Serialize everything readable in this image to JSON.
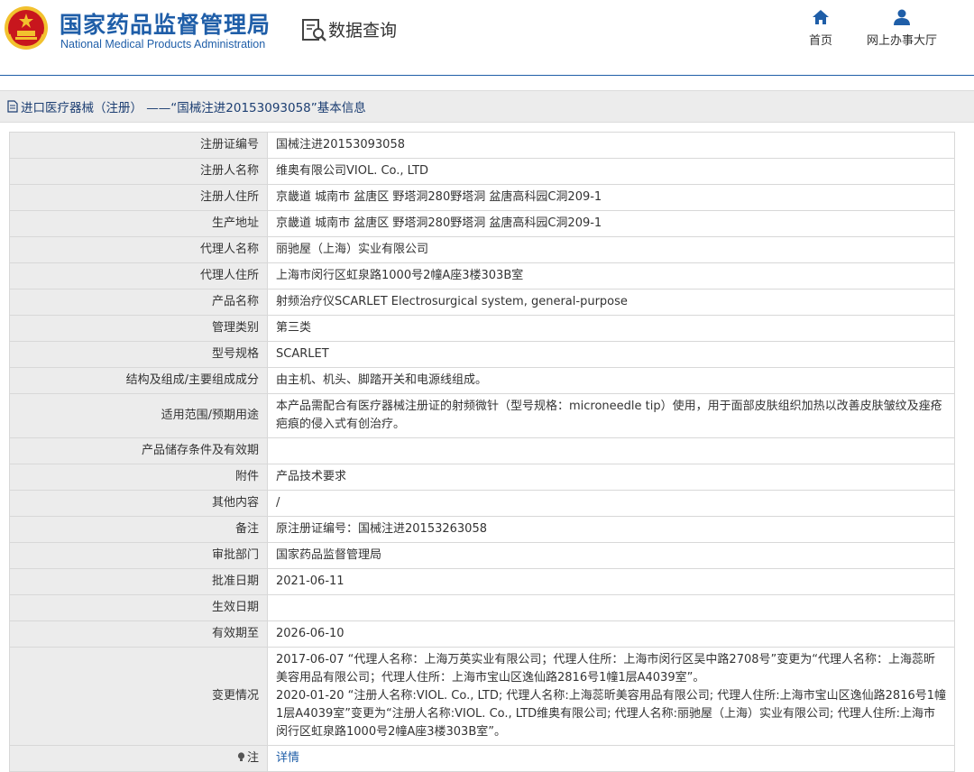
{
  "header": {
    "org_name_cn": "国家药品监督管理局",
    "org_name_en": "National Medical Products Administration",
    "section_title": "数据查询",
    "nav": [
      {
        "label": "首页",
        "icon": "home-icon"
      },
      {
        "label": "网上办事大厅",
        "icon": "user-icon"
      }
    ]
  },
  "page": {
    "title": "进口医疗器械（注册） ——“国械注进20153093058”基本信息"
  },
  "colors": {
    "brand_blue": "#1f5ea8",
    "title_text": "#1c3e72",
    "label_bg": "#ececec",
    "border": "#d8d8d8",
    "link": "#1f5ea8",
    "emblem_red": "#c8161d",
    "emblem_gold": "#f2c12e"
  },
  "record": {
    "rows": [
      {
        "label": "注册证编号",
        "value": "国械注进20153093058"
      },
      {
        "label": "注册人名称",
        "value": "维奥有限公司VIOL. Co., LTD"
      },
      {
        "label": "注册人住所",
        "value": "京畿道 城南市 盆唐区 野塔洞280野塔洞 盆唐高科园C洞209-1"
      },
      {
        "label": "生产地址",
        "value": "京畿道 城南市 盆唐区 野塔洞280野塔洞 盆唐高科园C洞209-1"
      },
      {
        "label": "代理人名称",
        "value": "丽驰屋（上海）实业有限公司"
      },
      {
        "label": "代理人住所",
        "value": "上海市闵行区虹泉路1000号2幢A座3楼303B室"
      },
      {
        "label": "产品名称",
        "value": "射频治疗仪SCARLET Electrosurgical system, general-purpose"
      },
      {
        "label": "管理类别",
        "value": "第三类"
      },
      {
        "label": "型号规格",
        "value": "SCARLET"
      },
      {
        "label": "结构及组成/主要组成成分",
        "value": "由主机、机头、脚踏开关和电源线组成。"
      },
      {
        "label": "适用范围/预期用途",
        "value": "本产品需配合有医疗器械注册证的射频微针（型号规格：microneedle tip）使用，用于面部皮肤组织加热以改善皮肤皱纹及痤疮疤痕的侵入式有创治疗。"
      },
      {
        "label": "产品储存条件及有效期",
        "value": ""
      },
      {
        "label": "附件",
        "value": "产品技术要求"
      },
      {
        "label": "其他内容",
        "value": "/"
      },
      {
        "label": "备注",
        "value": "原注册证编号：国械注进20153263058"
      },
      {
        "label": "审批部门",
        "value": "国家药品监督管理局"
      },
      {
        "label": "批准日期",
        "value": "2021-06-11"
      },
      {
        "label": "生效日期",
        "value": ""
      },
      {
        "label": "有效期至",
        "value": "2026-06-10"
      }
    ],
    "changes_label": "变更情况",
    "changes": [
      "2017-06-07 “代理人名称：上海万英实业有限公司；代理人住所：上海市闵行区吴中路2708号”变更为“代理人名称：上海蕊昕美容用品有限公司；代理人住所：上海市宝山区逸仙路2816号1幢1层A4039室”。",
      "2020-01-20 “注册人名称:VIOL. Co., LTD; 代理人名称:上海蕊昕美容用品有限公司; 代理人住所:上海市宝山区逸仙路2816号1幢1层A4039室”变更为“注册人名称:VIOL. Co., LTD维奥有限公司; 代理人名称:丽驰屋（上海）实业有限公司; 代理人住所:上海市闵行区虹泉路1000号2幢A座3楼303B室”。"
    ],
    "note_label": "注",
    "note_link": "详情"
  }
}
